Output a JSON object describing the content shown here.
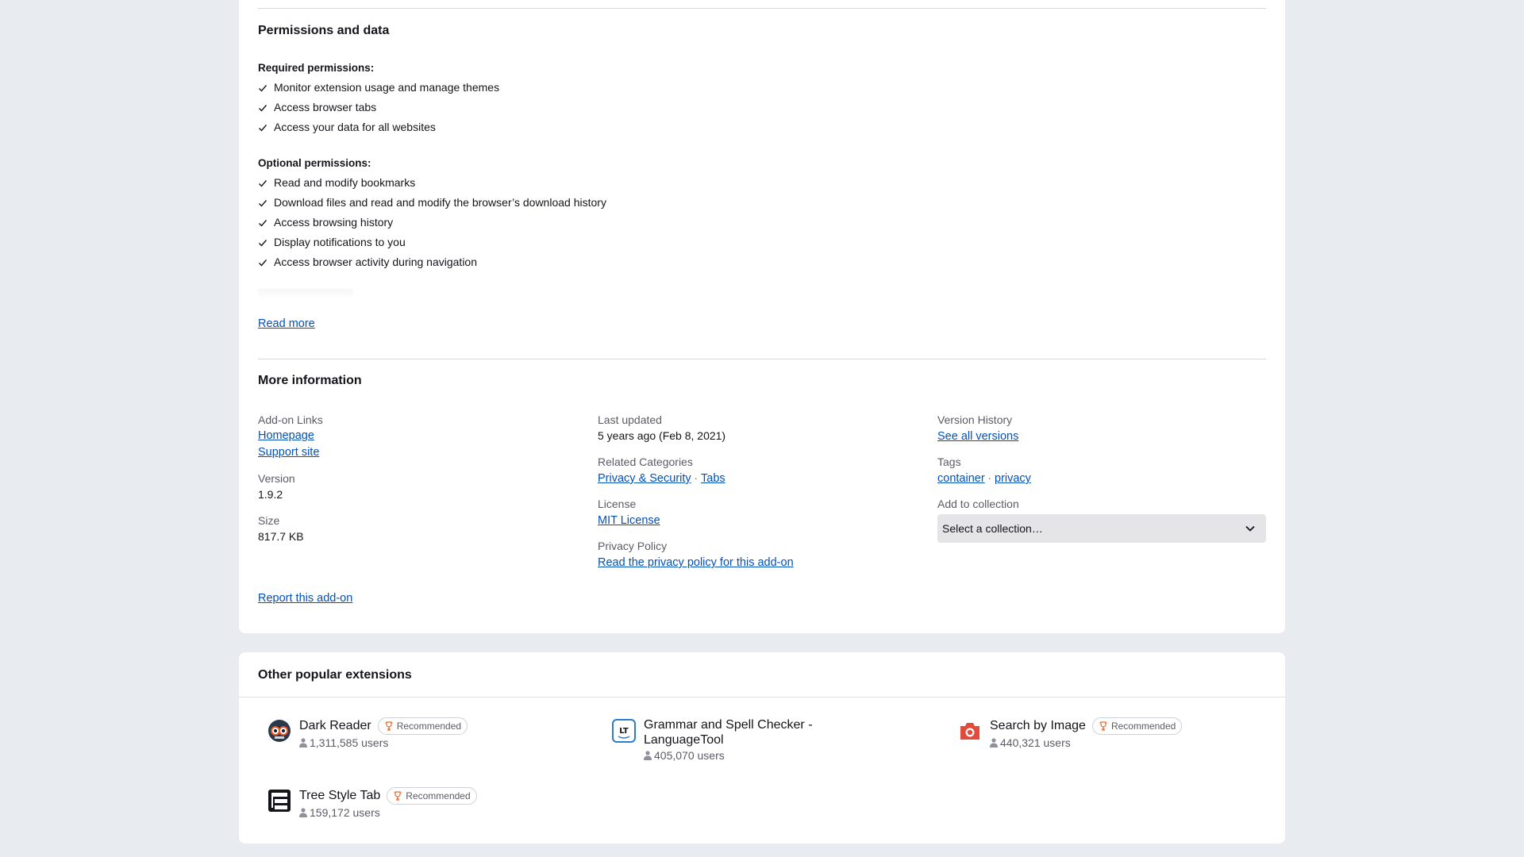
{
  "permissions": {
    "title": "Permissions and data",
    "required_heading": "Required permissions:",
    "required": [
      "Monitor extension usage and manage themes",
      "Access browser tabs",
      "Access your data for all websites"
    ],
    "optional_heading": "Optional permissions:",
    "optional": [
      "Read and modify bookmarks",
      "Download files and read and modify the browser’s download history",
      "Access browsing history",
      "Display notifications to you",
      "Access browser activity during navigation"
    ],
    "read_more": "Read more"
  },
  "more_info": {
    "title": "More information",
    "addon_links_label": "Add-on Links",
    "homepage": "Homepage",
    "support_site": "Support site",
    "version_label": "Version",
    "version": "1.9.2",
    "size_label": "Size",
    "size": "817.7 KB",
    "last_updated_label": "Last updated",
    "last_updated": "5 years ago (Feb 8, 2021)",
    "related_categories_label": "Related Categories",
    "category_1": "Privacy & Security",
    "category_2": "Tabs",
    "license_label": "License",
    "license": "MIT License",
    "privacy_label": "Privacy Policy",
    "privacy_link": "Read the privacy policy for this add-on",
    "version_history_label": "Version History",
    "see_all_versions": "See all versions",
    "tags_label": "Tags",
    "tag_1": "container",
    "tag_2": "privacy",
    "separator": "·",
    "collection_label": "Add to collection",
    "collection_placeholder": "Select a collection…",
    "report": "Report this add-on"
  },
  "popular": {
    "title": "Other popular extensions",
    "badge": "Recommended",
    "items": [
      {
        "name": "Dark Reader",
        "users": "1,311,585 users"
      },
      {
        "name": "Grammar and Spell Checker - LanguageTool",
        "users": "405,070 users"
      },
      {
        "name": "Search by Image",
        "users": "440,321 users"
      },
      {
        "name": "Tree Style Tab",
        "users": "159,172 users"
      }
    ]
  },
  "colors": {
    "link": "#0250bb",
    "background": "#e8ebef",
    "badge_icon": "#e66a2e",
    "search_by_image_icon": "#e24a3b",
    "languagetool_icon": "#2f7bd1"
  }
}
